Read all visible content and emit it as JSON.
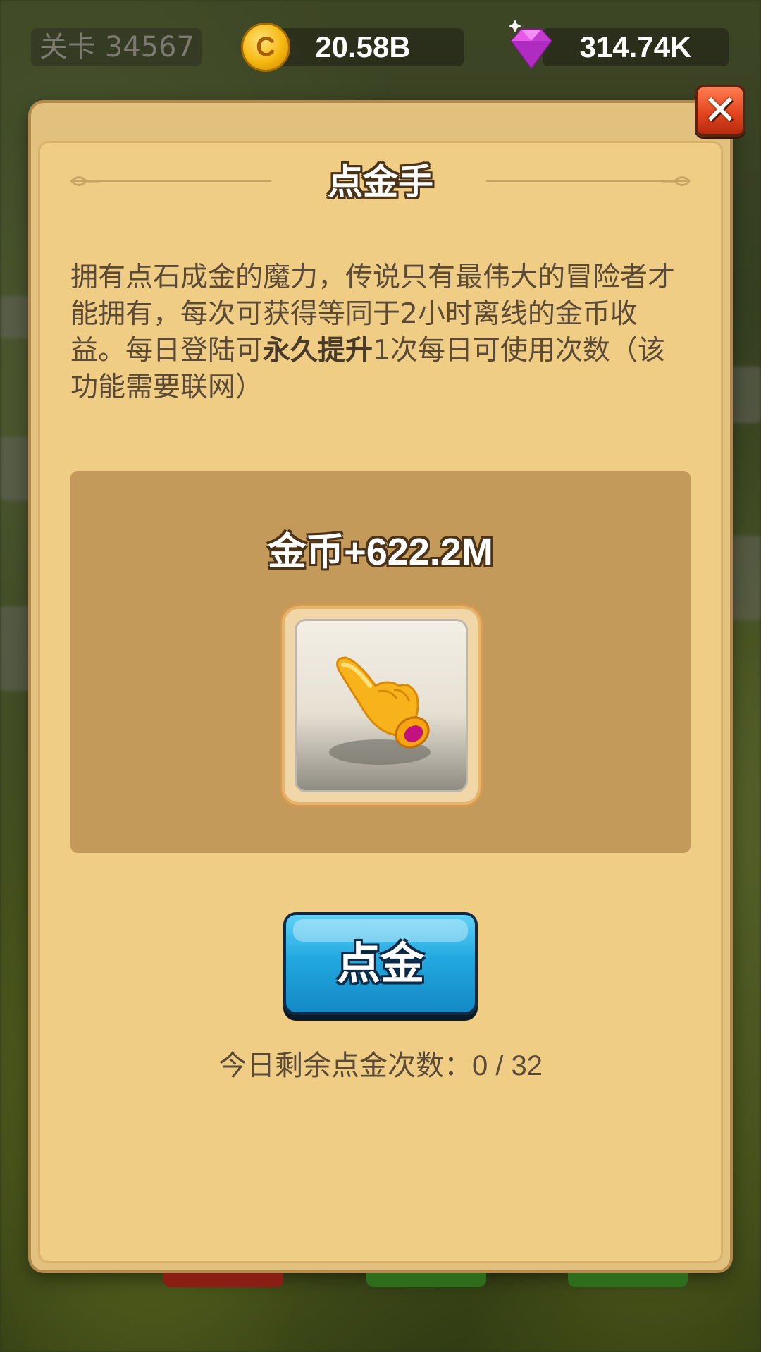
{
  "hud": {
    "level_label": "关卡 34567",
    "coins": "20.58B",
    "gems": "314.74K",
    "coin_icon_glyph": "C"
  },
  "dialog": {
    "title": "点金手",
    "description_part1": "拥有点石成金的魔力，传说只有最伟大的冒险者才能拥有，每次可获得等同于2小时离线的金币收益。每日登陆可",
    "description_bold": "永久提升",
    "description_part2": "1次每日可使用次数（该功能需要联网）",
    "reward_text": "金币+622.2M",
    "reward_icon": "golden-pointing-hand-icon",
    "action_button_label": "点金",
    "remaining_label": "今日剩余点金次数：",
    "remaining_count": "0 / 32",
    "close_icon": "close-x-icon"
  },
  "colors": {
    "panel_bg": "#f0cd85",
    "reward_box_bg": "#c49a5a",
    "button_blue": "#22a8e0",
    "close_red": "#e1421d",
    "text_brown": "#5a4a37"
  }
}
